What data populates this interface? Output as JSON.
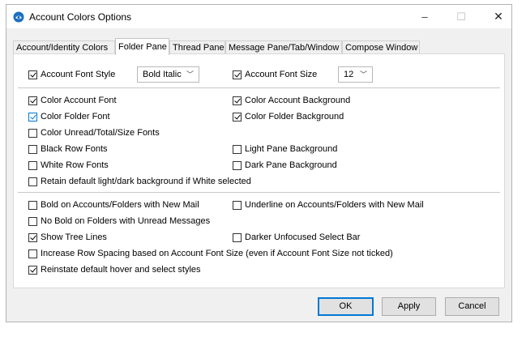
{
  "window": {
    "title": "Account Colors Options",
    "minimize": "–",
    "maximize": "☐",
    "close": "✕"
  },
  "tabs": [
    {
      "label": "Account/Identity Colors",
      "active": false
    },
    {
      "label": "Folder Pane",
      "active": true
    },
    {
      "label": "Thread Pane",
      "active": false
    },
    {
      "label": "Message Pane/Tab/Window",
      "active": false
    },
    {
      "label": "Compose Window",
      "active": false
    }
  ],
  "options": {
    "account_font_style": {
      "label": "Account Font Style",
      "checked": true,
      "value": "Bold Italic"
    },
    "account_font_size": {
      "label": "Account Font Size",
      "checked": true,
      "value": "12"
    },
    "color_account_font": {
      "label": "Color Account Font",
      "checked": true
    },
    "color_account_background": {
      "label": "Color Account Background",
      "checked": true
    },
    "color_folder_font": {
      "label": "Color Folder Font",
      "checked": true
    },
    "color_folder_background": {
      "label": "Color Folder Background",
      "checked": true
    },
    "color_unread_fonts": {
      "label": "Color Unread/Total/Size Fonts",
      "checked": false
    },
    "black_row_fonts": {
      "label": "Black Row Fonts",
      "checked": false
    },
    "light_pane_background": {
      "label": "Light Pane Background",
      "checked": false
    },
    "white_row_fonts": {
      "label": "White Row Fonts",
      "checked": false
    },
    "dark_pane_background": {
      "label": "Dark Pane Background",
      "checked": false
    },
    "retain_default_background": {
      "label": "Retain default light/dark background if White selected",
      "checked": false
    },
    "bold_new_mail": {
      "label": "Bold on Accounts/Folders with New Mail",
      "checked": false
    },
    "underline_new_mail": {
      "label": "Underline on Accounts/Folders with New Mail",
      "checked": false
    },
    "no_bold_unread": {
      "label": "No Bold on Folders with Unread Messages",
      "checked": false
    },
    "show_tree_lines": {
      "label": "Show Tree Lines",
      "checked": true
    },
    "darker_unfocused": {
      "label": "Darker Unfocused Select Bar",
      "checked": false
    },
    "increase_row_spacing": {
      "label": "Increase Row Spacing based on Account Font Size (even if Account Font Size not ticked)",
      "checked": false
    },
    "reinstate_hover": {
      "label": "Reinstate default hover and select styles",
      "checked": true
    }
  },
  "buttons": {
    "ok": "OK",
    "apply": "Apply",
    "cancel": "Cancel"
  },
  "icons": {
    "app": "thunderbird-icon",
    "dropdown": "chevron-down-icon"
  }
}
